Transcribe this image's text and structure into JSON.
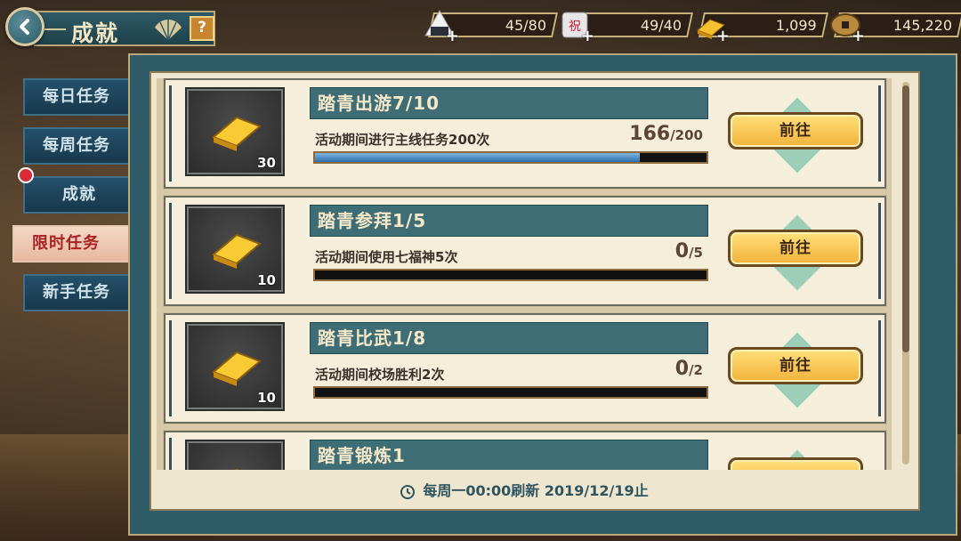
{
  "header": {
    "title": "成就",
    "help_label": "?"
  },
  "resources": [
    {
      "name": "stamina-rice-ball",
      "value": "45/80",
      "plus": "+"
    },
    {
      "name": "celebration-ticket",
      "value": "49/40",
      "plus": "+",
      "icon_text": "祝"
    },
    {
      "name": "gold-bar",
      "value": "1,099",
      "plus": "+"
    },
    {
      "name": "coin",
      "value": "145,220",
      "plus": "+"
    }
  ],
  "tabs": [
    {
      "label": "每日任务",
      "active": false
    },
    {
      "label": "每周任务",
      "active": false
    },
    {
      "label": "成就",
      "active": false,
      "badge": true
    },
    {
      "label": "限时任务",
      "active": true
    },
    {
      "label": "新手任务",
      "active": false
    }
  ],
  "quests": [
    {
      "title": "踏青出游7/10",
      "desc": "活动期间进行主线任务200次",
      "current": "166",
      "total": "/200",
      "progress": 0.83,
      "reward_count": "30",
      "button": "前往"
    },
    {
      "title": "踏青参拜1/5",
      "desc": "活动期间使用七福神5次",
      "current": "0",
      "total": "/5",
      "progress": 0,
      "reward_count": "10",
      "button": "前往"
    },
    {
      "title": "踏青比武1/8",
      "desc": "活动期间校场胜利2次",
      "current": "0",
      "total": "/2",
      "progress": 0,
      "reward_count": "10",
      "button": "前往"
    },
    {
      "title": "踏青锻炼1",
      "desc": "",
      "current": "",
      "total": "",
      "progress": 0,
      "reward_count": "",
      "button": ""
    }
  ],
  "footer": {
    "refresh_text": "每周一00:00刷新 2019/12/19止"
  },
  "colors": {
    "accent": "#2e5b68",
    "button": "#f3b13a",
    "badge": "#d92a3a"
  }
}
